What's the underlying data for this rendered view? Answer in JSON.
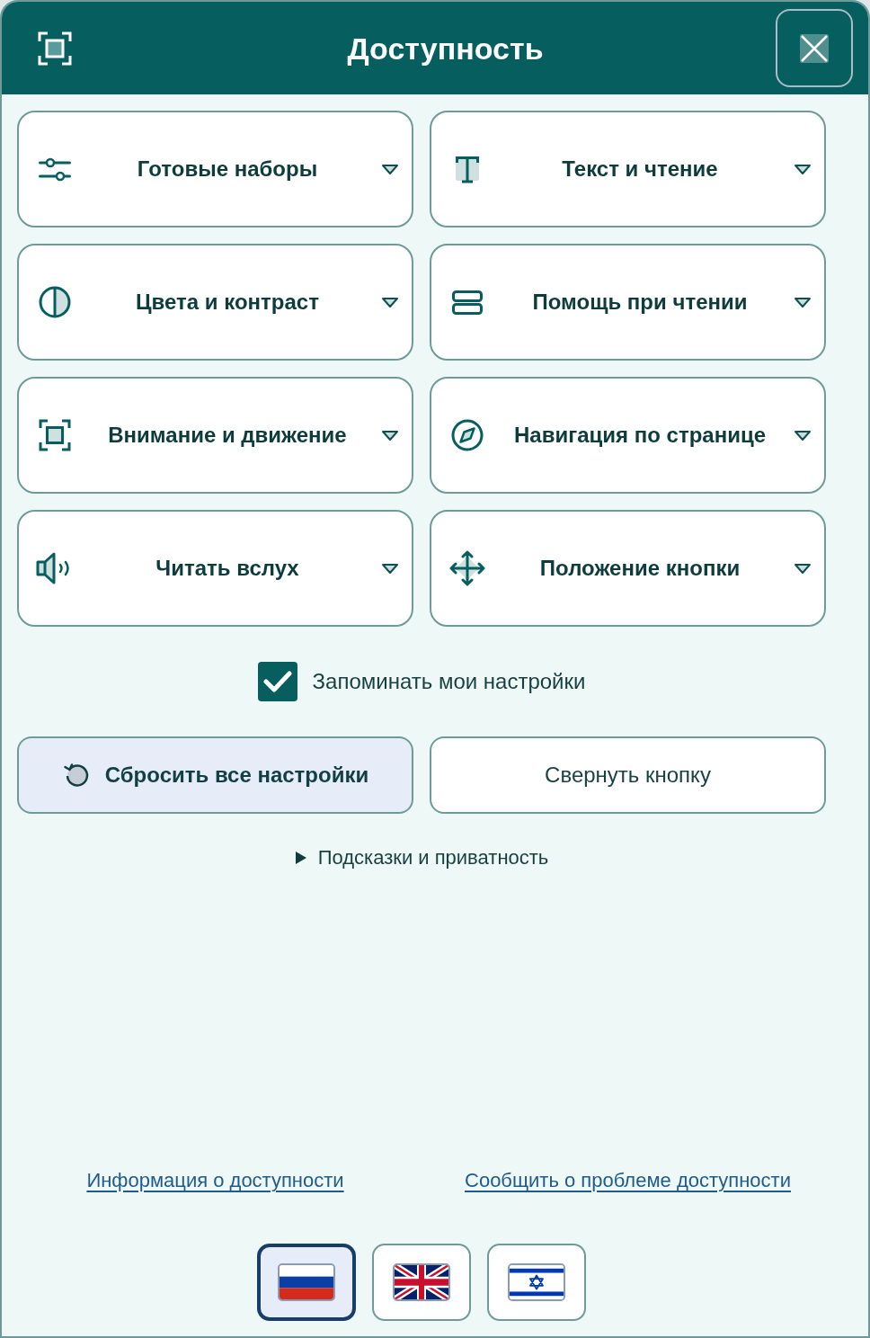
{
  "header": {
    "title": "Доступность"
  },
  "categories": [
    {
      "label": "Готовые наборы",
      "kind": "sliders"
    },
    {
      "label": "Текст и чтение",
      "kind": "text"
    },
    {
      "label": "Цвета и контраст",
      "kind": "contrast"
    },
    {
      "label": "Помощь при чтении",
      "kind": "rows"
    },
    {
      "label": "Внимание и движение",
      "kind": "focus"
    },
    {
      "label": "Навигация по странице",
      "kind": "compass"
    },
    {
      "label": "Читать вслух",
      "kind": "speaker"
    },
    {
      "label": "Положение кнопки",
      "kind": "move"
    }
  ],
  "remember_settings": {
    "label": "Запоминать мои настройки",
    "checked": true
  },
  "actions": [
    {
      "label": "Сбросить все настройки",
      "kind": "reset"
    },
    {
      "label": "Свернуть кнопку",
      "kind": "plain"
    }
  ],
  "hints": {
    "label": "Подсказки и приватность",
    "expanded": false
  },
  "links": [
    "Информация о доступности",
    "Сообщить о проблеме доступности"
  ],
  "languages": [
    {
      "kind": "russian",
      "selected": true
    },
    {
      "kind": "british",
      "selected": false
    },
    {
      "kind": "israeli",
      "selected": false
    }
  ]
}
